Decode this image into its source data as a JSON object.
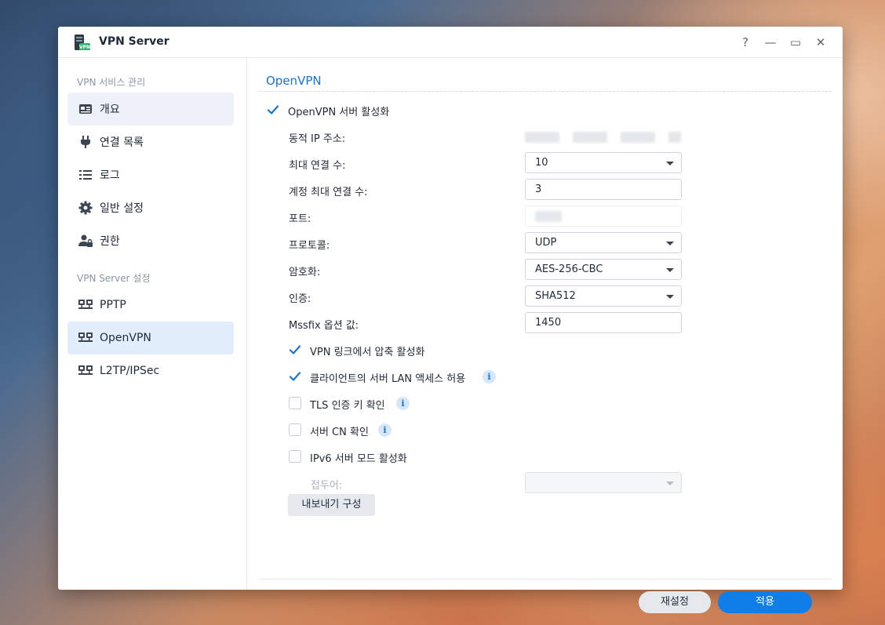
{
  "window": {
    "title": "VPN Server",
    "icon_text": "VPN"
  },
  "controls": {
    "help": "?",
    "minimize": "—",
    "maximize": "▭",
    "close": "✕"
  },
  "sidebar": {
    "group1": "VPN 서비스 관리",
    "group2": "VPN Server 설정",
    "items": [
      {
        "label": "개요",
        "icon": "overview-icon"
      },
      {
        "label": "연결 목록",
        "icon": "plug-icon"
      },
      {
        "label": "로그",
        "icon": "list-icon"
      },
      {
        "label": "일반 설정",
        "icon": "gear-icon"
      },
      {
        "label": "권한",
        "icon": "user-lock-icon"
      },
      {
        "label": "PPTP",
        "icon": "network-icon"
      },
      {
        "label": "OpenVPN",
        "icon": "network-icon"
      },
      {
        "label": "L2TP/IPSec",
        "icon": "network-icon"
      }
    ]
  },
  "main": {
    "section_title": "OpenVPN",
    "enable_label": "OpenVPN 서버 활성화",
    "fields": {
      "dynamic_ip_label": "동적 IP 주소:",
      "max_conn_label": "최대 연결 수:",
      "max_conn_value": "10",
      "account_max_label": "계정 최대 연결 수:",
      "account_max_value": "3",
      "port_label": "포트:",
      "protocol_label": "프로토콜:",
      "protocol_value": "UDP",
      "encryption_label": "암호화:",
      "encryption_value": "AES-256-CBC",
      "auth_label": "인증:",
      "auth_value": "SHA512",
      "mssfix_label": "Mssfix 옵션 값:",
      "mssfix_value": "1450",
      "prefix_label": "접두어:",
      "prefix_value": ""
    },
    "options": {
      "compression_label": "VPN 링크에서 압축 활성화",
      "compression_checked": true,
      "lan_access_label": "클라이언트의 서버 LAN 액세스 허용",
      "lan_access_checked": true,
      "tls_label": "TLS 인증 키 확인",
      "tls_checked": false,
      "cn_label": "서버 CN 확인",
      "cn_checked": false,
      "ipv6_label": "IPv6 서버 모드 활성화",
      "ipv6_checked": false
    },
    "info_glyph": "i",
    "export_button": "내보내기 구성"
  },
  "footer": {
    "reset": "재설정",
    "apply": "적용"
  },
  "colors": {
    "accent": "#0f7ee8",
    "section_title": "#1873d3",
    "active_item": "#e2eefb"
  }
}
